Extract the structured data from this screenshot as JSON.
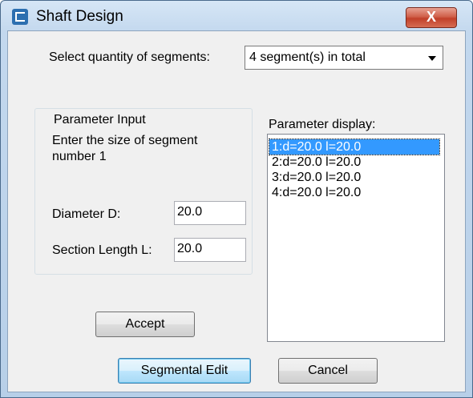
{
  "window": {
    "title": "Shaft Design",
    "close_label": "X"
  },
  "segments": {
    "label": "Select quantity of segments:",
    "selected": "4 segment(s) in total"
  },
  "parameter_input": {
    "legend": "Parameter Input",
    "prompt_line1": "Enter the size of segment",
    "prompt_line2": "number 1",
    "diameter_label": "Diameter D:",
    "diameter_value": "20.0",
    "length_label": "Section Length L:",
    "length_value": "20.0"
  },
  "parameter_display": {
    "label": "Parameter display:",
    "items": [
      "1:d=20.0  l=20.0",
      "2:d=20.0  l=20.0",
      "3:d=20.0  l=20.0",
      "4:d=20.0  l=20.0"
    ],
    "selected_index": 0
  },
  "buttons": {
    "accept": "Accept",
    "segmental_edit": "Segmental Edit",
    "cancel": "Cancel"
  },
  "colors": {
    "selection": "#3399ff",
    "close_button": "#c1402a"
  }
}
